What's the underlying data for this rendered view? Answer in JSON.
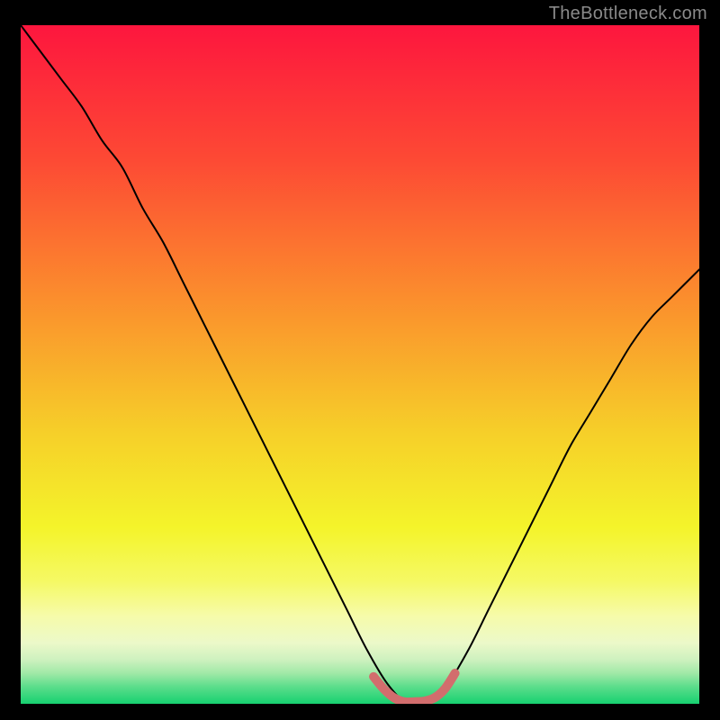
{
  "watermark": "TheBottleneck.com",
  "chart_data": {
    "type": "line",
    "title": "",
    "xlabel": "",
    "ylabel": "",
    "xlim": [
      0,
      100
    ],
    "ylim": [
      0,
      100
    ],
    "series": [
      {
        "name": "curve",
        "color": "#000000",
        "x": [
          0,
          3,
          6,
          9,
          12,
          15,
          18,
          21,
          24,
          27,
          30,
          33,
          36,
          39,
          42,
          45,
          48,
          51,
          54,
          57,
          60,
          63,
          66,
          69,
          72,
          75,
          78,
          81,
          84,
          87,
          90,
          93,
          96,
          100
        ],
        "values": [
          100,
          96,
          92,
          88,
          83,
          79,
          73,
          68,
          62,
          56,
          50,
          44,
          38,
          32,
          26,
          20,
          14,
          8,
          3,
          0,
          0,
          3,
          8,
          14,
          20,
          26,
          32,
          38,
          43,
          48,
          53,
          57,
          60,
          64
        ]
      },
      {
        "name": "highlight",
        "color": "#d26d6d",
        "x": [
          52,
          53.5,
          55,
          56.5,
          58,
          59.5,
          61,
          62.5,
          64
        ],
        "values": [
          4,
          2.2,
          0.9,
          0.3,
          0.3,
          0.4,
          0.9,
          2.2,
          4.5
        ]
      }
    ],
    "background_gradient": {
      "stops": [
        {
          "offset": 0.0,
          "color": "#fd163e"
        },
        {
          "offset": 0.2,
          "color": "#fd4a34"
        },
        {
          "offset": 0.4,
          "color": "#fb8d2d"
        },
        {
          "offset": 0.6,
          "color": "#f6cf29"
        },
        {
          "offset": 0.74,
          "color": "#f4f42a"
        },
        {
          "offset": 0.82,
          "color": "#f5f965"
        },
        {
          "offset": 0.87,
          "color": "#f6fba9"
        },
        {
          "offset": 0.91,
          "color": "#ecf9c9"
        },
        {
          "offset": 0.935,
          "color": "#cef1bf"
        },
        {
          "offset": 0.955,
          "color": "#a0e9a7"
        },
        {
          "offset": 0.975,
          "color": "#5bdd8b"
        },
        {
          "offset": 1.0,
          "color": "#17d170"
        }
      ]
    }
  }
}
